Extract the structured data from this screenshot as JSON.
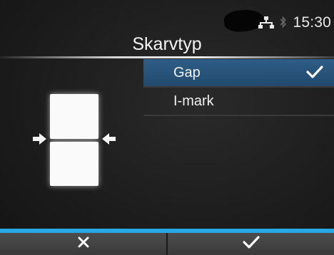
{
  "status": {
    "time": "15:30",
    "icons": [
      "network-icon",
      "bluetooth-icon"
    ]
  },
  "header": {
    "title": "Skarvtyp"
  },
  "options": [
    {
      "label": "Gap",
      "selected": true
    },
    {
      "label": "I-mark",
      "selected": false
    }
  ],
  "illustration": {
    "icon": "gap-sensor-illustration"
  },
  "footer": {
    "cancel_icon": "close-icon",
    "confirm_icon": "check-icon"
  },
  "colors": {
    "accent": "#29a8e6",
    "selection": "#2a5680",
    "background": "#1d1d1d"
  }
}
